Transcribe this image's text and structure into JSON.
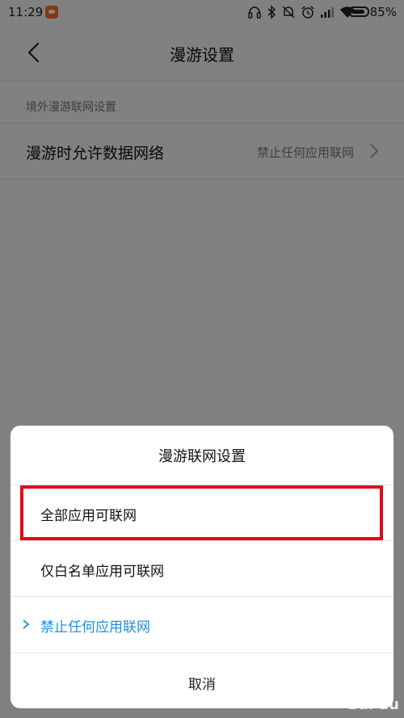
{
  "status_bar": {
    "time": "11:29",
    "battery": "85%"
  },
  "header": {
    "title": "漫游设置"
  },
  "section": {
    "label": "境外漫游联网设置"
  },
  "setting": {
    "title": "漫游时允许数据网络",
    "value": "禁止任何应用联网"
  },
  "sheet": {
    "title": "漫游联网设置",
    "options": [
      {
        "label": "全部应用可联网"
      },
      {
        "label": "仅白名单应用可联网"
      },
      {
        "label": "禁止任何应用联网"
      }
    ],
    "cancel": "取消"
  },
  "colors": {
    "accent": "#1a8fe8",
    "highlight": "#e3061a"
  }
}
